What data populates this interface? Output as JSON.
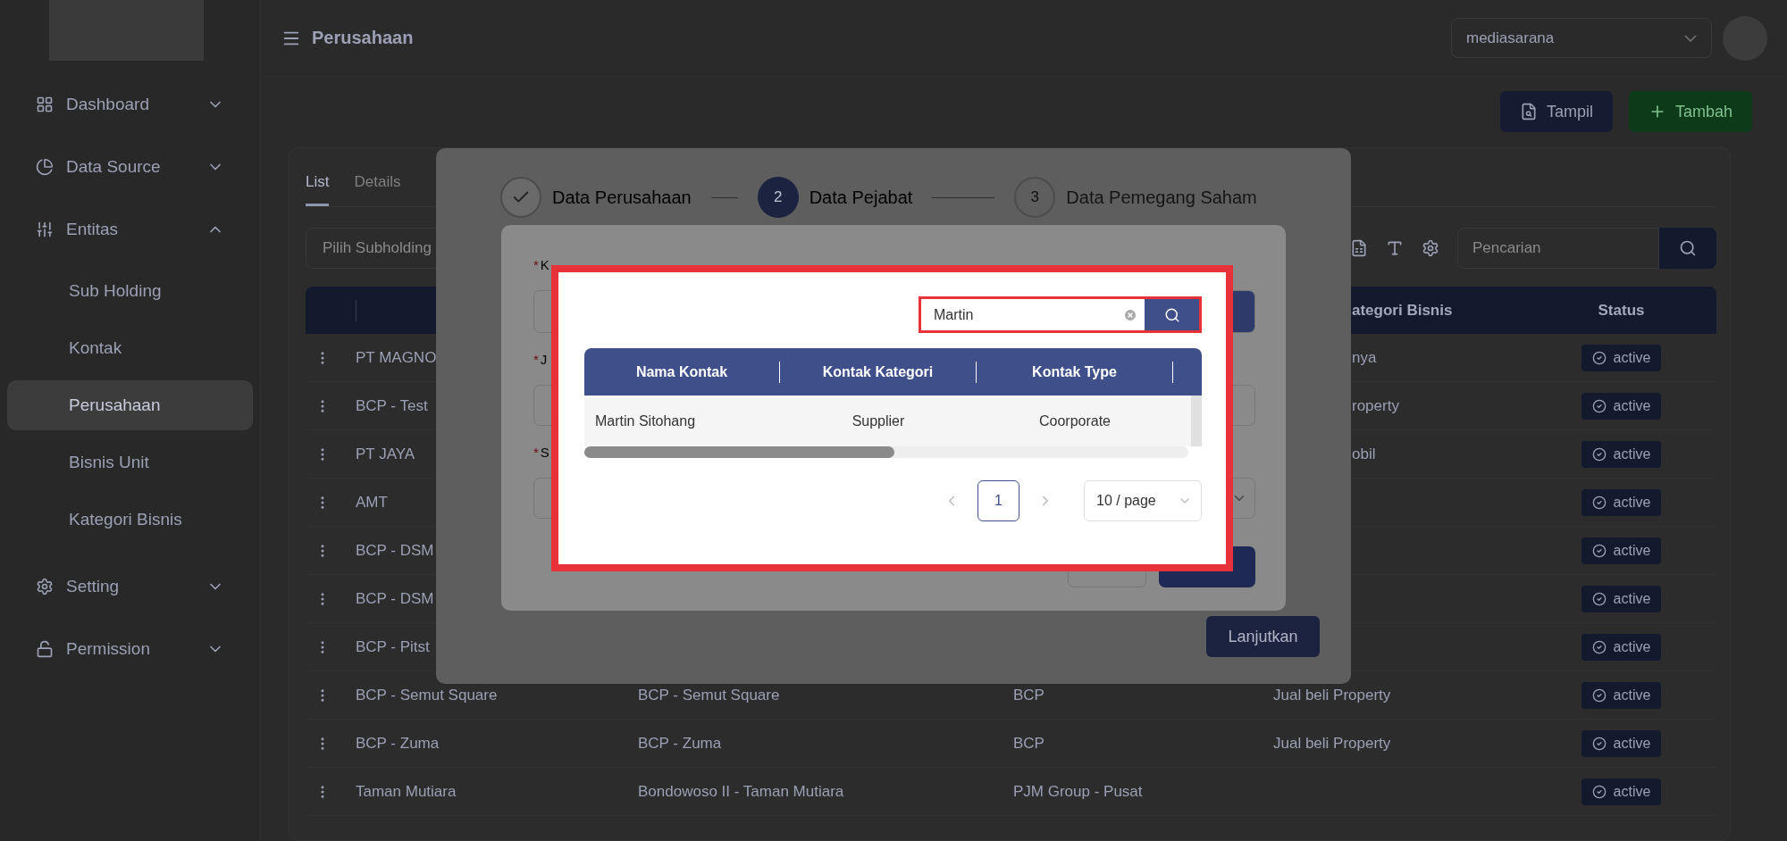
{
  "sidebar": {
    "items": [
      {
        "label": "Dashboard",
        "expanded": false,
        "selected": false
      },
      {
        "label": "Data Source",
        "expanded": false,
        "selected": false
      },
      {
        "label": "Entitas",
        "expanded": true,
        "selected": false,
        "children": [
          {
            "label": "Sub Holding",
            "selected": false
          },
          {
            "label": "Kontak",
            "selected": false
          },
          {
            "label": "Perusahaan",
            "selected": true
          },
          {
            "label": "Bisnis Unit",
            "selected": false
          },
          {
            "label": "Kategori Bisnis",
            "selected": false
          }
        ]
      },
      {
        "label": "Setting",
        "expanded": false,
        "selected": false
      },
      {
        "label": "Permission",
        "expanded": false,
        "selected": false
      }
    ]
  },
  "header": {
    "title": "Perusahaan",
    "company": "mediasarana"
  },
  "actions": [
    {
      "label": "Tampil",
      "kind": "primary"
    },
    {
      "label": "Tambah",
      "kind": "success"
    }
  ],
  "card": {
    "tabs": [
      {
        "label": "List",
        "selected": true
      },
      {
        "label": "Details",
        "selected": false
      }
    ],
    "filter": {
      "placeholder": "Pilih Subholding"
    },
    "search": {
      "placeholder": "Pencarian"
    },
    "table": {
      "columns": [
        {
          "label": "ategori Bisnis"
        },
        {
          "label": "Status"
        }
      ],
      "rows": [
        {
          "name": "PT MAGNO",
          "category": "nya",
          "status": "active"
        },
        {
          "name": "BCP - Test",
          "category": "roperty",
          "status": "active"
        },
        {
          "name": "PT JAYA",
          "category": "obil",
          "status": "active"
        },
        {
          "name": "AMT",
          "status": "active"
        },
        {
          "name": "BCP - DSM",
          "status": "active"
        },
        {
          "name": "BCP - DSM",
          "status": "active"
        },
        {
          "name": "BCP - Pitst",
          "status": "active"
        },
        {
          "name": "BCP - Semut Square",
          "column_2": "BCP - Semut Square",
          "column_3": "BCP",
          "category": "Jual beli Property",
          "status": "active"
        },
        {
          "name": "BCP - Zuma",
          "column_2": "BCP - Zuma",
          "column_3": "BCP",
          "category": "Jual beli Property",
          "status": "active"
        },
        {
          "name": "Taman Mutiara",
          "column_2": "Bondowoso II - Taman Mutiara",
          "column_3": "PJM Group - Pusat",
          "status": "active"
        }
      ]
    }
  },
  "wizard": {
    "steps": [
      {
        "label": "Data Perusahaan",
        "finished": true,
        "selected": false
      },
      {
        "number": "2",
        "label": "Data Pejabat",
        "finished": false,
        "selected": true
      },
      {
        "number": "3",
        "label": "Data Pemegang Saham",
        "finished": false,
        "selected": false
      }
    ],
    "next_button": "Lanjutkan"
  },
  "form": {
    "fields": [
      {
        "mark": "*",
        "label": "K",
        "kind": "lookup"
      },
      {
        "mark": "*",
        "label": "J",
        "kind": "text"
      },
      {
        "mark": "*",
        "label": "S",
        "kind": "select"
      }
    ]
  },
  "lookup": {
    "search": {
      "value": "Martin"
    },
    "columns": [
      "Nama Kontak",
      "Kontak Kategori",
      "Kontak Type"
    ],
    "rows": [
      [
        "Martin Sitohang",
        "Supplier",
        "Coorporate"
      ]
    ],
    "pagination": {
      "pages": [
        {
          "label": "1",
          "selected": true
        }
      ],
      "page_size": "10 / page"
    }
  }
}
